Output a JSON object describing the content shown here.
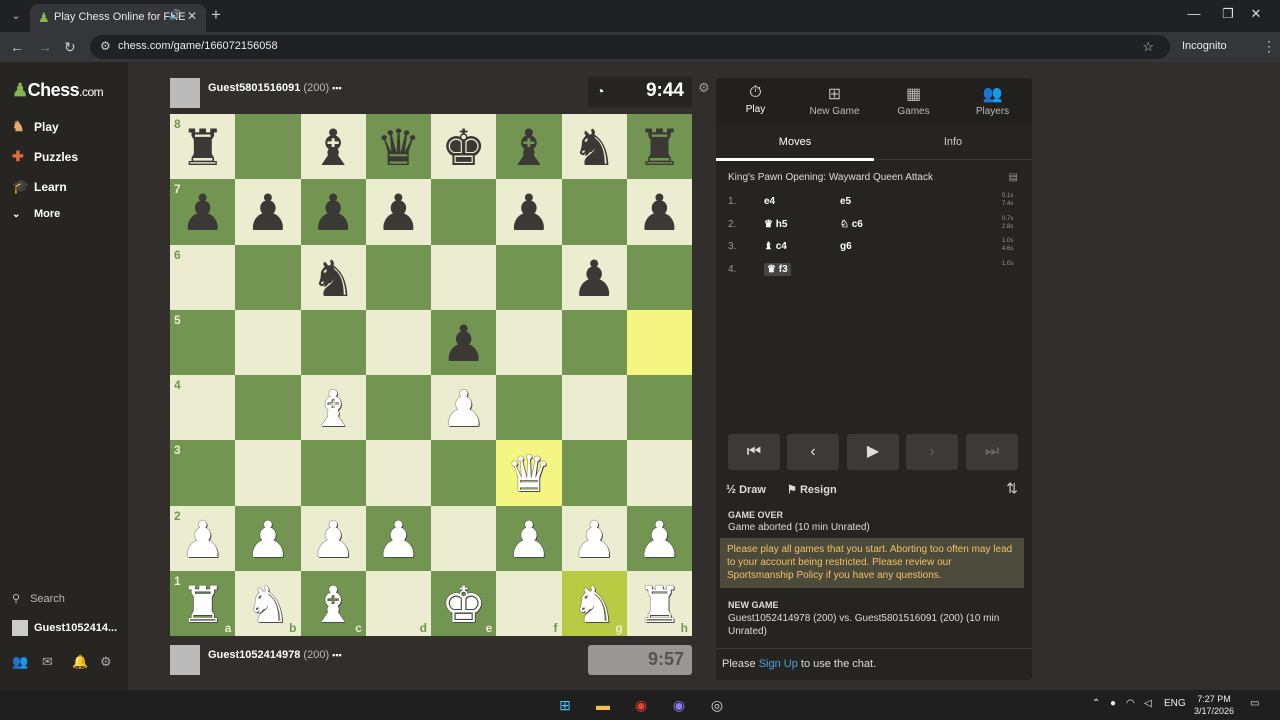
{
  "browser": {
    "tab_title": "Play Chess Online for FREE",
    "url": "chess.com/game/166072156058",
    "incognito_label": "Incognito"
  },
  "sidebar": {
    "logo_text": "Chess",
    "logo_suffix": ".com",
    "items": [
      {
        "label": "Play",
        "icon": "play-icon"
      },
      {
        "label": "Puzzles",
        "icon": "puzzle-icon"
      },
      {
        "label": "Learn",
        "icon": "learn-icon"
      },
      {
        "label": "More",
        "icon": "chevron-down-icon"
      }
    ],
    "search_label": "Search",
    "user_label": "Guest1052414..."
  },
  "top_player": {
    "name": "Guest5801516091",
    "rating": "(200)"
  },
  "bottom_player": {
    "name": "Guest1052414978",
    "rating": "(200)"
  },
  "clocks": {
    "top": "9:44",
    "bottom": "9:57"
  },
  "board": {
    "ranks": [
      "8",
      "7",
      "6",
      "5",
      "4",
      "3",
      "2",
      "1"
    ],
    "files": [
      "a",
      "b",
      "c",
      "d",
      "e",
      "f",
      "g",
      "h"
    ],
    "highlight_squares": [
      "h5",
      "f3"
    ],
    "highlight_g1": true,
    "pieces": {
      "a8": "♜",
      "c8": "♝",
      "d8": "♛",
      "e8": "♚",
      "f8": "♝",
      "g8": "♞",
      "h8": "♜",
      "a7": "♟",
      "b7": "♟",
      "c7": "♟",
      "d7": "♟",
      "f7": "♟",
      "h7": "♟",
      "c6": "♞",
      "g6": "♟",
      "e5": "♟",
      "c4": "♗",
      "e4": "♙",
      "f3": "♕",
      "a2": "♙",
      "b2": "♙",
      "c2": "♙",
      "d2": "♙",
      "f2": "♙",
      "g2": "♙",
      "h2": "♙",
      "a1": "♖",
      "b1": "♘",
      "c1": "♗",
      "e1": "♔",
      "g1": "♘",
      "h1": "♖"
    },
    "white_pieces": [
      "c4",
      "e4",
      "f3",
      "a2",
      "b2",
      "c2",
      "d2",
      "f2",
      "g2",
      "h2",
      "a1",
      "b1",
      "c1",
      "e1",
      "g1",
      "h1"
    ]
  },
  "panel": {
    "tabs": [
      {
        "label": "Play",
        "icon": "stopwatch-icon"
      },
      {
        "label": "New Game",
        "icon": "plus-icon"
      },
      {
        "label": "Games",
        "icon": "board-icon"
      },
      {
        "label": "Players",
        "icon": "players-icon"
      }
    ],
    "subtabs": [
      "Moves",
      "Info"
    ],
    "opening": "King's Pawn Opening: Wayward Queen Attack",
    "moves": [
      {
        "num": "1.",
        "white": "e4",
        "black": "e5",
        "t1": "0.1s",
        "t2": "7.4s"
      },
      {
        "num": "2.",
        "white": "♛ h5",
        "black": "♘ c6",
        "t1": "0.7s",
        "t2": "2.8s"
      },
      {
        "num": "3.",
        "white": "♝ c4",
        "black": "g6",
        "t1": "1.0s",
        "t2": "4.6s"
      },
      {
        "num": "4.",
        "white": "♛ f3",
        "black": "",
        "t1": "1.0s",
        "t2": ""
      }
    ],
    "draw_label": "Draw",
    "resign_label": "Resign",
    "game_over_heading": "GAME OVER",
    "game_over_text": "Game aborted (10 min Unrated)",
    "warning": "Please play all games that you start. Aborting too often may lead to your account being restricted. Please review our Sportsmanship Policy if you have any questions.",
    "new_game_heading": "NEW GAME",
    "new_game_text": "Guest1052414978 (200) vs. Guest5801516091 (200) (10 min Unrated)",
    "chat_prefix": "Please",
    "chat_link": "Sign Up",
    "chat_suffix": "to use the chat."
  },
  "taskbar": {
    "lang": "ENG",
    "time": "7:27 PM",
    "date": "3/17/2026"
  }
}
